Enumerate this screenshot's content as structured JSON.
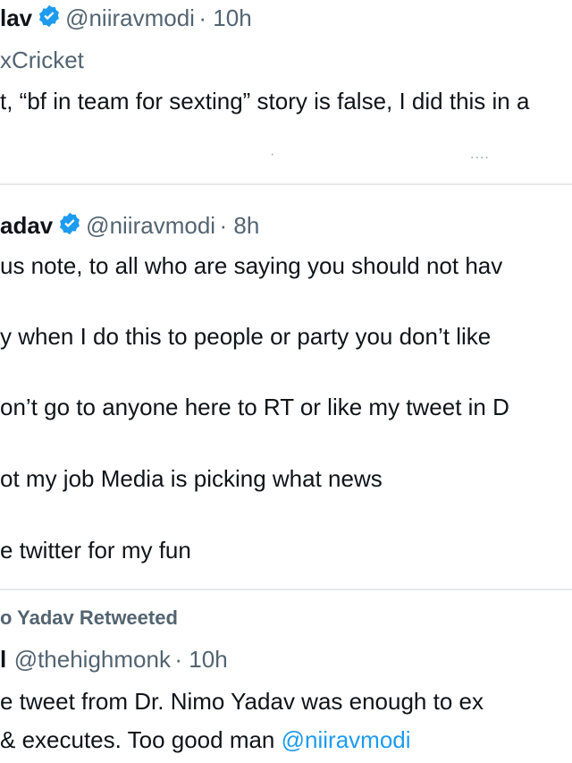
{
  "tweet1": {
    "name_fragment": "lav",
    "handle": "@niiravmodi",
    "time": "· 10h",
    "reply_context": "xCricket",
    "text": "t, “bf in team for sexting” story is false, I did this in a",
    "action_dot": "·",
    "more": "...."
  },
  "tweet2": {
    "name_fragment": "adav",
    "handle": "@niiravmodi",
    "time": "· 8h",
    "lines": [
      "us note, to all who are saying you should not hav",
      "y when I do this to people or party you don’t like",
      "on’t go to anyone here to RT or like my tweet in D",
      "ot my job Media is picking what news",
      "e twitter for my fun"
    ]
  },
  "tweet3": {
    "retweeted_by": "o Yadav Retweeted",
    "name_fragment": "l",
    "handle": "@thehighmonk",
    "time": "· 10h",
    "line1": "e tweet from Dr. Nimo Yadav was enough to ex",
    "line2_prefix": "& executes. Too good man",
    "mention": "@niiravmodi"
  },
  "colors": {
    "verified": "#1d9bf0",
    "link": "#1d9bf0",
    "handle": "#536471",
    "divider": "#e6e9eb"
  }
}
